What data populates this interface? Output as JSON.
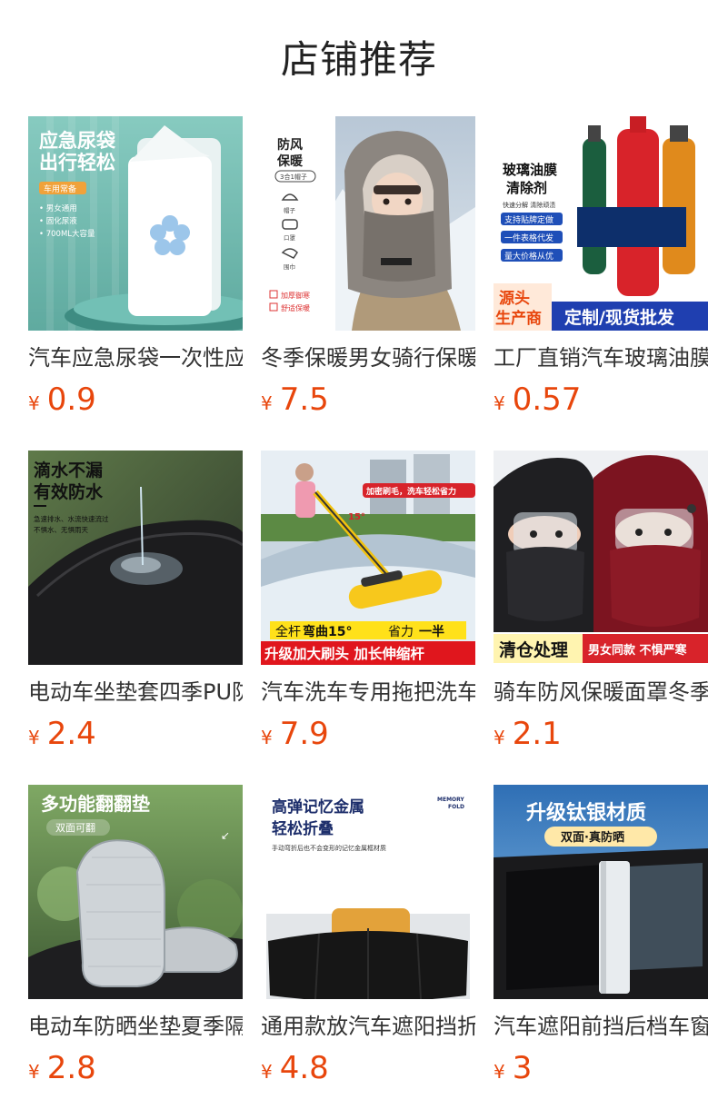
{
  "page": {
    "title": "店铺推荐"
  },
  "products": [
    {
      "title": "汽车应急尿袋一次性应急尿袋",
      "currency": "¥",
      "price": "0.9",
      "image": {
        "lines": [
          "应急尿袋",
          "出行轻松"
        ],
        "tag": "车用常备",
        "bullets": [
          "• 男女通用",
          "• 固化尿液",
          "• 700ML大容量"
        ]
      }
    },
    {
      "title": "冬季保暖男女骑行保暖头套",
      "currency": "¥",
      "price": "7.5",
      "image": {
        "lines": [
          "防风",
          "保暖"
        ],
        "tag": "3合1帽子",
        "icons": [
          "帽子",
          "口罩",
          "围巾"
        ],
        "checks": [
          "加厚御寒",
          "舒适保暖"
        ]
      }
    },
    {
      "title": "工厂直销汽车玻璃油膜清除剂",
      "currency": "¥",
      "price": "0.57",
      "image": {
        "lines": [
          "玻璃油膜",
          "清除剂"
        ],
        "sub": "快速分解 清除顽渍",
        "chips": [
          "支持贴牌定做",
          "一件表格代发",
          "量大价格从优"
        ],
        "badge_lines": [
          "源头",
          "生产商"
        ],
        "banner": "定制/现货批发"
      }
    },
    {
      "title": "电动车坐垫套四季PU防水坐垫套",
      "currency": "¥",
      "price": "2.4",
      "image": {
        "lines": [
          "滴水不漏",
          "有效防水"
        ],
        "sub_lines": [
          "急速排水、水流快速流过",
          "不惧水、无惧雨天"
        ]
      }
    },
    {
      "title": "汽车洗车专用拖把洗车刷",
      "currency": "¥",
      "price": "7.9",
      "image": {
        "top_tag": "加密刷毛，洗车轻松省力",
        "angle": "15°",
        "band1_parts": [
          "全杆",
          "弯曲15°",
          "省力",
          "一半"
        ],
        "band2": "升级加大刷头 加长伸缩杆"
      }
    },
    {
      "title": "骑车防风保暖面罩冬季",
      "currency": "¥",
      "price": "2.1",
      "image": {
        "banner_left": "清仓处理",
        "banner_right": "男女同款 不惧严寒"
      }
    },
    {
      "title": "电动车防晒坐垫夏季隔热垫",
      "currency": "¥",
      "price": "2.8",
      "image": {
        "lines": [
          "多功能翻翻垫"
        ],
        "tag": "双面可翻"
      }
    },
    {
      "title": "通用款放汽车遮阳挡折叠",
      "currency": "¥",
      "price": "4.8",
      "image": {
        "lines": [
          "高弹记忆金属",
          "轻松折叠"
        ],
        "brand": [
          "MEMORY",
          "FOLD"
        ],
        "sub": "手动弯折后也不会变形的记忆金属框材质"
      }
    },
    {
      "title": "汽车遮阳前挡后档车窗遮阳帘",
      "currency": "¥",
      "price": "3",
      "image": {
        "lines": [
          "升级钛银材质"
        ],
        "tag": "双面·真防晒"
      }
    }
  ],
  "colors": {
    "price": "#e8460c",
    "text": "#333333"
  }
}
